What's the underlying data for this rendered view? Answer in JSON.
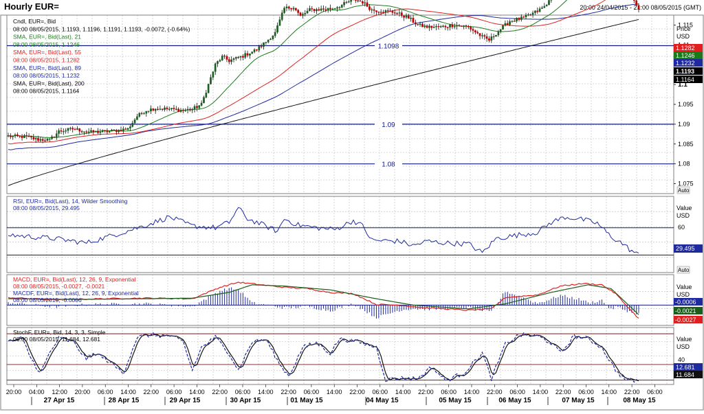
{
  "window": {
    "title": "Hourly EUR=",
    "date_range": "20:00 24/04/2015 - 21:00 08/05/2015 (GMT)"
  },
  "colors": {
    "background": "#ffffff",
    "grid": "#b8b8b8",
    "frame": "#7f7f7f",
    "candle_up": "#1b5e20",
    "candle_down": "#c00000",
    "candle_wick": "#111111",
    "sma21": "#1a7a1a",
    "sma55": "#e02020",
    "sma89": "#1f2a9e",
    "sma200": "#111111",
    "hline": "#101a80",
    "rsi": "#1f2a9e",
    "macd": "#e02020",
    "macd_signal": "#1a5e1a",
    "macdf": "#1f2a9e",
    "stoch_k": "#1f2a9e",
    "stoch_d": "#111111"
  },
  "price_panel": {
    "legend": [
      "Cndl, EUR=, Bid",
      "08:00 08/05/2015, 1.1193, 1.1196, 1.1191, 1.1193, -0.0072, (-0.64%)",
      "SMA, EUR=, Bid(Last), 21",
      "08:00 08/05/2015, 1.1246",
      "SMA, EUR=, Bid(Last), 55",
      "08:00 08/05/2015, 1.1282",
      "SMA, EUR=, Bid(Last), 89",
      "08:00 08/05/2015, 1.1232",
      "SMA, EUR=, Bid(Last), 200",
      "08:00 08/05/2015, 1.1164"
    ],
    "axis_header": [
      "Price",
      "USD"
    ],
    "axis_ticks": [
      "1.115",
      "1.11",
      "1.105",
      "1.1",
      "1.095",
      "1.09",
      "1.085",
      "1.08",
      "1.075"
    ],
    "last_value_tags": [
      {
        "label": "1.1282",
        "value": 1.1282,
        "color": "#e02020",
        "text": "#ffffff"
      },
      {
        "label": "1.1246",
        "value": 1.1246,
        "color": "#1a7a1a",
        "text": "#ffffff"
      },
      {
        "label": "1.1232",
        "value": 1.1232,
        "color": "#1f2a9e",
        "text": "#ffffff"
      },
      {
        "label": "1.1193",
        "value": 1.1193,
        "color": "#000000",
        "text": "#ffffff"
      },
      {
        "label": "1.1164",
        "value": 1.1164,
        "color": "#000000",
        "text": "#ffffff"
      }
    ],
    "horizontal_lines": [
      {
        "label": "1.1098",
        "value": 1.1098
      },
      {
        "label": "1.09",
        "value": 1.09
      },
      {
        "label": "1.08",
        "value": 1.08
      }
    ],
    "auto_label": "Auto"
  },
  "rsi_panel": {
    "legend": [
      "RSI, EUR=, Bid(Last), 14, Wilder Smoothing",
      "08:00 08/05/2015, 29.495"
    ],
    "axis_header": [
      "Value",
      "USD"
    ],
    "axis_ticks": [
      "60"
    ],
    "last_value_tag": {
      "label": "29.495",
      "value": 29.495
    },
    "auto_label": "Auto"
  },
  "macd_panel": {
    "legend": [
      "MACD, EUR=, Bid(Last), 12, 26, 9, Exponential",
      "08:00 08/05/2015, -0.0027, -0.0021",
      "MACDF, EUR=, Bid(Last), 12, 26, 9, Exponential",
      "08:00 08/05/2015, -0.0006"
    ],
    "axis_header": [
      "Value",
      "USD"
    ],
    "last_value_tags": [
      {
        "label": "-0.0006",
        "value": -0.0006,
        "color": "#1f2a9e"
      },
      {
        "label": "-0.0021",
        "value": -0.0021,
        "color": "#1a5e1a"
      },
      {
        "label": "-0.0027",
        "value": -0.0027,
        "color": "#e02020"
      }
    ]
  },
  "stoch_panel": {
    "legend": [
      "StochF, EUR=, Bid, 14, 3, 3, Simple",
      "08:00 08/05/2015, 11.684, 12.681"
    ],
    "axis_header": [
      "Value",
      "USD"
    ],
    "axis_ticks": [
      "40"
    ],
    "last_value_tags": [
      {
        "label": "12.681",
        "value": 12.681
      },
      {
        "label": "11.684",
        "value": 11.684
      }
    ]
  },
  "time_axis": {
    "hour_labels": [
      "20:00",
      "04:00",
      "12:00",
      "20:00",
      "06:00",
      "14:00",
      "22:00",
      "06:00",
      "14:00",
      "22:00",
      "06:00",
      "14:00",
      "22:00",
      "06:00",
      "14:00",
      "22:00",
      "06:00",
      "14:00",
      "22:00",
      "06:00",
      "14:00",
      "22:00",
      "06:00",
      "14:00",
      "22:00",
      "06:00",
      "14:00",
      "22:00",
      "06:00",
      "14:00"
    ],
    "day_labels": [
      "27 Apr 15",
      "28 Apr 15",
      "29 Apr 15",
      "30 Apr 15",
      "01 May 15",
      "04 May 15",
      "05 May 15",
      "06 May 15",
      "07 May 15",
      "08 May 15"
    ]
  },
  "chart_data": [
    {
      "type": "candlestick",
      "title": "Hourly EUR=",
      "ylabel": "Price USD",
      "ylim": [
        1.0725,
        1.1175
      ],
      "grid": true,
      "key_points": [
        {
          "t": "27 Apr 04:00",
          "price": 1.0868
        },
        {
          "t": "27 Apr 20:00",
          "price": 1.0885
        },
        {
          "t": "28 Apr 14:00",
          "price": 1.094
        },
        {
          "t": "29 Apr 14:00",
          "price": 1.107
        },
        {
          "t": "30 Apr 06:00",
          "price": 1.1105
        },
        {
          "t": "30 Apr 14:00",
          "price": 1.12
        },
        {
          "t": "01 May 06:00",
          "price": 1.1215
        },
        {
          "t": "01 May 22:00",
          "price": 1.119
        },
        {
          "t": "05 May 06:00",
          "price": 1.11
        },
        {
          "t": "06 May 14:00",
          "price": 1.128
        },
        {
          "t": "07 May 06:00",
          "price": 1.132
        },
        {
          "t": "08 May 08:00",
          "price": 1.1193
        }
      ],
      "sma": [
        {
          "name": "SMA 21",
          "last": 1.1246
        },
        {
          "name": "SMA 55",
          "last": 1.1282
        },
        {
          "name": "SMA 89",
          "last": 1.1232
        },
        {
          "name": "SMA 200",
          "last": 1.1164
        }
      ],
      "horizontal_lines": [
        1.1098,
        1.09,
        1.08
      ]
    },
    {
      "type": "line",
      "title": "RSI 14",
      "series": [
        {
          "name": "RSI",
          "last": 29.495
        }
      ],
      "reference_lines": [
        60
      ]
    },
    {
      "type": "line",
      "title": "MACD 12 26 9",
      "series": [
        {
          "name": "MACD",
          "last": -0.0027
        },
        {
          "name": "Signal",
          "last": -0.0021
        },
        {
          "name": "MACDF",
          "last": -0.0006
        }
      ]
    },
    {
      "type": "line",
      "title": "StochF 14 3 3",
      "series": [
        {
          "name": "%K",
          "last": 11.684
        },
        {
          "name": "%D",
          "last": 12.681
        }
      ],
      "reference_lines": [
        40
      ]
    }
  ]
}
